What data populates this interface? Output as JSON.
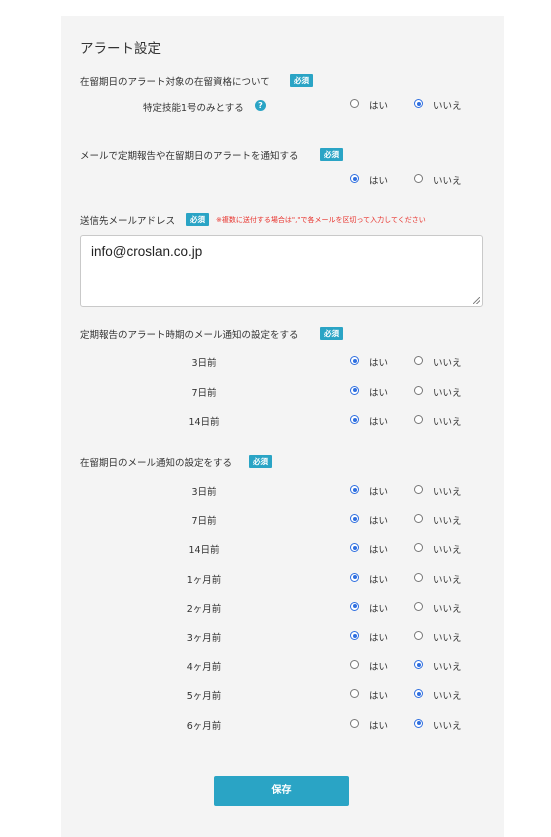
{
  "title": "アラート設定",
  "required_label": "必須",
  "yes_label": "はい",
  "no_label": "いいえ",
  "q1": {
    "label": "在留期日のアラート対象の在留資格について",
    "row_label": "特定技能1号のみとする",
    "help_icon": "question-circle-icon",
    "value": "no"
  },
  "q2": {
    "label": "メールで定期報告や在留期日のアラートを通知する",
    "value": "yes"
  },
  "email": {
    "label": "送信先メールアドレス",
    "note": "※複数に送付する場合は\",\"で各メールを区切って入力してください",
    "value": "info@croslan.co.jp"
  },
  "q3": {
    "label": "定期報告のアラート時期のメール通知の設定をする",
    "rows": [
      {
        "label": "3日前",
        "value": "yes"
      },
      {
        "label": "7日前",
        "value": "yes"
      },
      {
        "label": "14日前",
        "value": "yes"
      }
    ]
  },
  "q4": {
    "label": "在留期日のメール通知の設定をする",
    "rows": [
      {
        "label": "3日前",
        "value": "yes"
      },
      {
        "label": "7日前",
        "value": "yes"
      },
      {
        "label": "14日前",
        "value": "yes"
      },
      {
        "label": "1ヶ月前",
        "value": "yes"
      },
      {
        "label": "2ヶ月前",
        "value": "yes"
      },
      {
        "label": "3ヶ月前",
        "value": "yes"
      },
      {
        "label": "4ヶ月前",
        "value": "no"
      },
      {
        "label": "5ヶ月前",
        "value": "no"
      },
      {
        "label": "6ヶ月前",
        "value": "no"
      }
    ]
  },
  "save_label": "保存",
  "colors": {
    "accent": "#2aa4c5",
    "radio": "#2f6fe0",
    "note": "#e8302a",
    "panel": "#f4f4f4"
  }
}
